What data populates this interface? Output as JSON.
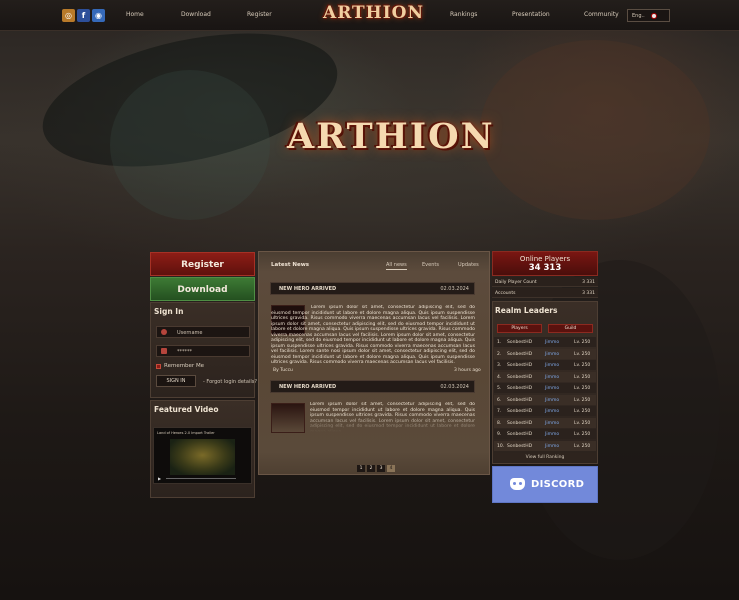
{
  "nav": {
    "links": [
      "Home",
      "Download",
      "Register",
      "Rankings",
      "Presentation",
      "Community"
    ],
    "logo": "ARTHION",
    "language": "Eng.."
  },
  "hero": {
    "logo": "ARTHION"
  },
  "left": {
    "register_button": "Register",
    "download_button": "Download",
    "signin_title": "Sign In",
    "username_placeholder": "Username",
    "password_value": "******",
    "remember_label": "Remember Me",
    "signin_button": "SIGN IN",
    "forgot_link": "- Forgot login details?",
    "video_title": "Featured Video",
    "video_caption": "Land of Heroes 2.0 Import Trailer"
  },
  "news": {
    "title": "Latest News",
    "tabs": [
      "All news",
      "Events",
      "Updates"
    ],
    "items": [
      {
        "title": "NEW HERO ARRIVED",
        "date": "02.03.2024",
        "body": "Lorem ipsum dolor sit amet, consectetur adipiscing elit, sed do eiusmod tempor incididunt ut labore et dolore magna aliqua. Quis ipsum suspendisse ultrices gravida. Risus commodo viverra maecenas accumsan lacus vel facilisis. Lorem ipsum dolor sit amet, consectetur adipiscing elit, sed do eiusmod tempor incididunt ut labore et dolore magna aliqua. Quis ipsum suspendisse ultrices gravida. Risus commodo viverra maecenas accumsan lacus vel facilisis. Lorem ipsum dolor sit amet, consectetur adipiscing elit, sed do eiusmod tempor incididunt ut labore et dolore magna aliqua. Quis ipsum suspendisse ultrices gravida. Risus commodo viverra maecenas accumsan lacus vel facilisis. Lorem sante nosi ipsum dolor sit amet, consectetur adipiscing elit, sed do eiusmod tempor incididunt ut labore et dolore magna aliqua. Quis ipsum suspendisse ultrices gravida. Risus commodo viverra maecenas accumsan lacus vel facilisis.",
        "author": "By Tuccu",
        "time": "3 hours ago"
      },
      {
        "title": "NEW HERO ARRIVED",
        "date": "02.03.2024",
        "body": "Lorem ipsum dolor sit amet, consectetur adipiscing elit, sed do eiusmod tempor incididunt ut labore et dolore magna aliqua. Quis ipsum suspendisse ultrices gravida. Risus commodo viverra maecenas accumsan lacus vel facilisis. Lorem ipsum dolor sit amet, consectetur adipiscing elit, sed do eiusmod tempor incididunt ut labore et dolore magna aliqua."
      }
    ],
    "pages": [
      "1",
      "2",
      "3",
      "4"
    ]
  },
  "online": {
    "title": "Online Players",
    "count": "34 313",
    "stats": [
      {
        "label": "Daily Player Count",
        "value": "3 331"
      },
      {
        "label": "Accounts",
        "value": "3 331"
      }
    ]
  },
  "ranking": {
    "title": "Realm Leaders",
    "tabs": [
      "Players",
      "Guild"
    ],
    "rows": [
      {
        "rank": "1.",
        "name": "SonbestHD",
        "guild": "Jimmo",
        "level": "Lv. 250"
      },
      {
        "rank": "2.",
        "name": "SonbestHD",
        "guild": "Jimmo",
        "level": "Lv. 250"
      },
      {
        "rank": "3.",
        "name": "SonbestHD",
        "guild": "Jimmo",
        "level": "Lv. 250"
      },
      {
        "rank": "4.",
        "name": "SonbestHD",
        "guild": "Jimmo",
        "level": "Lv. 250"
      },
      {
        "rank": "5.",
        "name": "SonbestHD",
        "guild": "Jimmo",
        "level": "Lv. 250"
      },
      {
        "rank": "6.",
        "name": "SonbestHD",
        "guild": "Jimmo",
        "level": "Lv. 250"
      },
      {
        "rank": "7.",
        "name": "SonbestHD",
        "guild": "Jimmo",
        "level": "Lv. 250"
      },
      {
        "rank": "8.",
        "name": "SonbestHD",
        "guild": "Jimmo",
        "level": "Lv. 250"
      },
      {
        "rank": "9.",
        "name": "SonbestHD",
        "guild": "Jimmo",
        "level": "Lv. 250"
      },
      {
        "rank": "10.",
        "name": "SonbestHD",
        "guild": "Jimmo",
        "level": "Lv. 250"
      }
    ],
    "view_all": "View full Ranking"
  },
  "discord": {
    "label": "DISCORD"
  },
  "colors": {
    "accent_red": "#7a1612",
    "green": "#2f6a2a",
    "discord": "#7289da",
    "gold": "#f0cfa0"
  }
}
